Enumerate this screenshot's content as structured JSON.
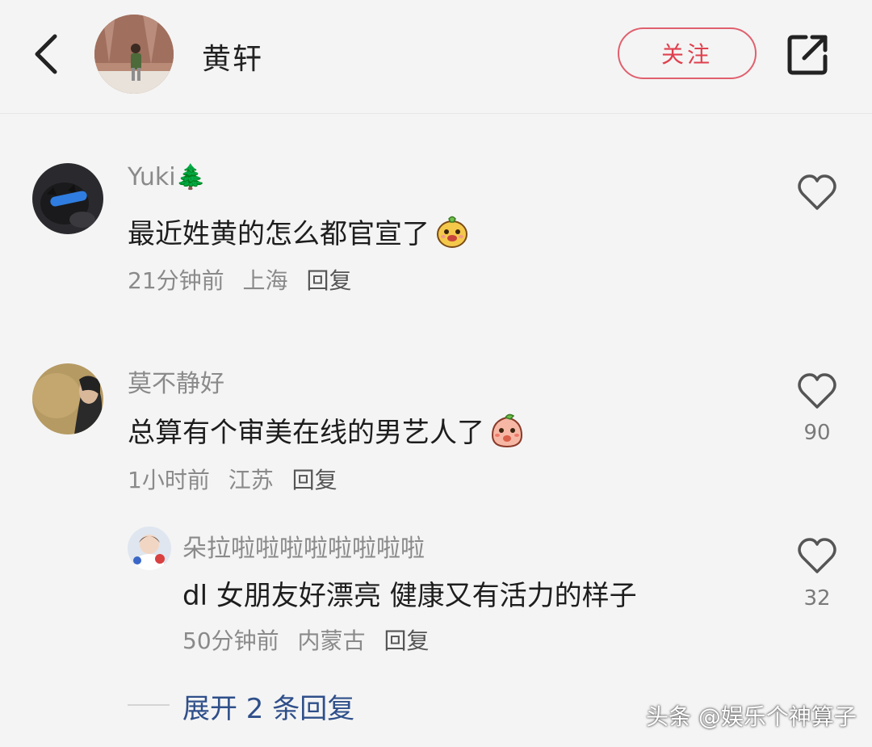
{
  "header": {
    "title": "黄轩",
    "follow_label": "关注",
    "icons": {
      "back": "chevron-left-icon",
      "share": "share-icon"
    }
  },
  "comments": [
    {
      "username": "Yuki🌲",
      "text": "最近姓黄的怎么都官宣了",
      "emoji": "dog-face-emoji",
      "time": "21分钟前",
      "location": "上海",
      "reply_label": "回复",
      "likes": ""
    },
    {
      "username": "莫不静好",
      "text": "总算有个审美在线的男艺人了",
      "emoji": "peach-blush-emoji",
      "time": "1小时前",
      "location": "江苏",
      "reply_label": "回复",
      "likes": "90"
    }
  ],
  "reply": {
    "username": "朵拉啦啦啦啦啦啦啦啦",
    "text": "dl 女朋友好漂亮 健康又有活力的样子",
    "time": "50分钟前",
    "location": "内蒙古",
    "reply_label": "回复",
    "likes": "32"
  },
  "expand": {
    "label": "展开 2 条回复"
  },
  "watermark": "头条 @娱乐个神算子",
  "colors": {
    "accent": "#e0404e",
    "link": "#2f4f8a",
    "background": "#f4f4f4"
  }
}
